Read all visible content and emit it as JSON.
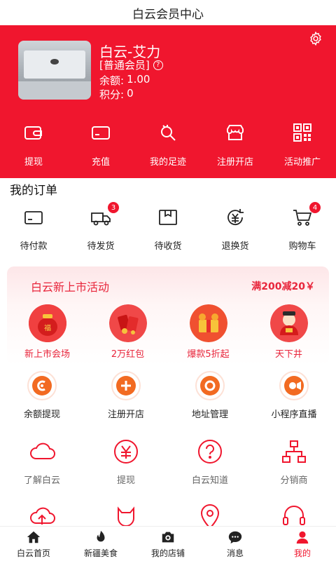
{
  "title": "白云会员中心",
  "user": {
    "name": "白云-艾力",
    "level": "[普通会员]",
    "balance_label": "余额:",
    "balance": "1.00",
    "points_label": "积分:",
    "points": "0"
  },
  "quick_actions": [
    {
      "label": "提现",
      "icon": "wallet-icon"
    },
    {
      "label": "充值",
      "icon": "card-icon"
    },
    {
      "label": "我的足迹",
      "icon": "footprint-icon"
    },
    {
      "label": "注册开店",
      "icon": "store-icon"
    },
    {
      "label": "活动推广",
      "icon": "qrcode-icon"
    }
  ],
  "orders": {
    "title": "我的订单",
    "items": [
      {
        "label": "待付款",
        "icon": "card-icon",
        "badge": ""
      },
      {
        "label": "待发货",
        "icon": "truck-icon",
        "badge": "3"
      },
      {
        "label": "待收货",
        "icon": "package-icon",
        "badge": ""
      },
      {
        "label": "退换货",
        "icon": "refund-icon",
        "badge": ""
      },
      {
        "label": "购物车",
        "icon": "cart-icon",
        "badge": "4"
      }
    ]
  },
  "promo": {
    "title": "白云新上市活动",
    "tag": "满200减20￥",
    "items": [
      {
        "label": "新上市会场",
        "icon": "lucky-bag-icon"
      },
      {
        "label": "2万红包",
        "icon": "red-envelope-icon"
      },
      {
        "label": "爆款5折起",
        "icon": "gift-box-icon"
      },
      {
        "label": "天下井",
        "icon": "fortune-god-icon"
      }
    ]
  },
  "services_row1": [
    {
      "label": "余额提现",
      "icon": "coin-icon"
    },
    {
      "label": "注册开店",
      "icon": "plus-icon"
    },
    {
      "label": "地址管理",
      "icon": "location-ring-icon"
    },
    {
      "label": "小程序直播",
      "icon": "camera-icon"
    }
  ],
  "services_row2": [
    {
      "label": "了解白云",
      "icon": "cloud-icon"
    },
    {
      "label": "提现",
      "icon": "yuan-icon"
    },
    {
      "label": "白云知道",
      "icon": "question-icon"
    },
    {
      "label": "分销商",
      "icon": "network-icon"
    }
  ],
  "services_row3": [
    {
      "icon": "cloud-upload-icon"
    },
    {
      "icon": "cat-icon"
    },
    {
      "icon": "map-pin-icon"
    },
    {
      "icon": "headset-icon"
    }
  ],
  "tabbar": [
    {
      "label": "白云首页",
      "icon": "home-icon"
    },
    {
      "label": "新疆美食",
      "icon": "fire-icon"
    },
    {
      "label": "我的店铺",
      "icon": "shop-camera-icon"
    },
    {
      "label": "消息",
      "icon": "chat-icon"
    },
    {
      "label": "我的",
      "icon": "user-icon",
      "active": true
    }
  ],
  "colors": {
    "primary": "#f0162e",
    "promo_text": "#e8253b",
    "accent_orange": "#f26a21"
  }
}
